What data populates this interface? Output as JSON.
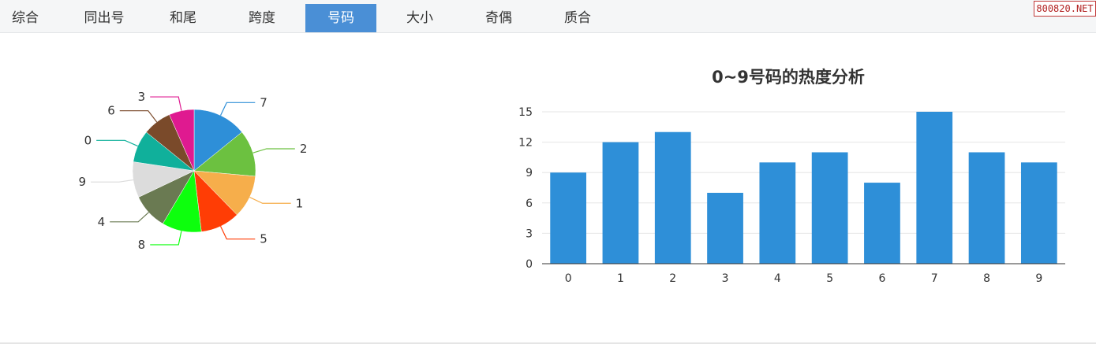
{
  "tabs": [
    {
      "label": "综合",
      "active": false
    },
    {
      "label": "同出号",
      "active": false
    },
    {
      "label": "和尾",
      "active": false
    },
    {
      "label": "跨度",
      "active": false
    },
    {
      "label": "号码",
      "active": true
    },
    {
      "label": "大小",
      "active": false
    },
    {
      "label": "奇偶",
      "active": false
    },
    {
      "label": "质合",
      "active": false
    }
  ],
  "watermark": "800820.NET",
  "chart_data": [
    {
      "type": "pie",
      "slices": [
        {
          "label": "7",
          "value": 15,
          "color": "#2e8fd8"
        },
        {
          "label": "2",
          "value": 13,
          "color": "#6cc140"
        },
        {
          "label": "1",
          "value": 12,
          "color": "#f6ae4b"
        },
        {
          "label": "5",
          "value": 11,
          "color": "#ff3d05"
        },
        {
          "label": "8",
          "value": 11,
          "color": "#0dff0d"
        },
        {
          "label": "4",
          "value": 10,
          "color": "#6a7a52"
        },
        {
          "label": "9",
          "value": 10,
          "color": "#dcdcdc"
        },
        {
          "label": "0",
          "value": 9,
          "color": "#10b09b"
        },
        {
          "label": "6",
          "value": 8,
          "color": "#7a4a2a"
        },
        {
          "label": "3",
          "value": 7,
          "color": "#df1a90"
        }
      ]
    },
    {
      "type": "bar",
      "title": "0~9号码的热度分析",
      "categories": [
        "0",
        "1",
        "2",
        "3",
        "4",
        "5",
        "6",
        "7",
        "8",
        "9"
      ],
      "values": [
        9,
        12,
        13,
        7,
        10,
        11,
        8,
        15,
        11,
        10
      ],
      "ylim": [
        0,
        15
      ],
      "yticks": [
        0,
        3,
        6,
        9,
        12,
        15
      ],
      "grid": true,
      "bar_color": "#2e8fd8"
    }
  ]
}
